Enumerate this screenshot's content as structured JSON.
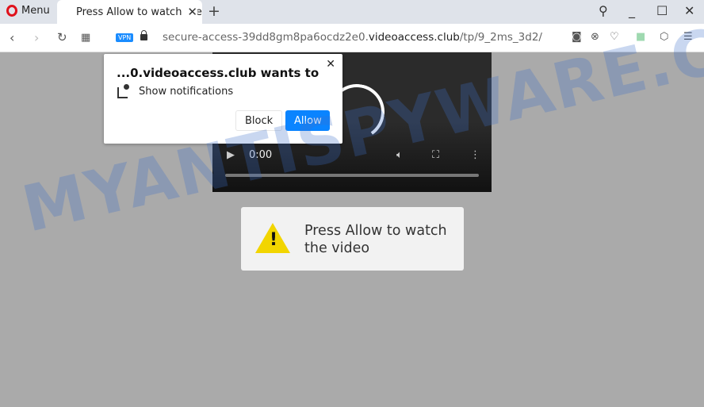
{
  "browser": {
    "menu_label": "Menu",
    "tab_title": "Press Allow to watch the video",
    "url_prefix": "secure-access-39dd8gm8pa6ocdz2e0.",
    "url_domain": "videoaccess.club",
    "url_path": "/tp/9_2ms_3d2/",
    "vpn_badge": "VPN"
  },
  "popup": {
    "title": "...0.videoaccess.club wants to",
    "permission": "Show notifications",
    "block_label": "Block",
    "allow_label": "Allow"
  },
  "video": {
    "time": "0:00"
  },
  "message": {
    "text": "Press Allow to watch the video"
  },
  "watermark": "MYANTISPYWARE.COM",
  "colors": {
    "accent": "#0a84ff",
    "warning": "#f2d500"
  }
}
